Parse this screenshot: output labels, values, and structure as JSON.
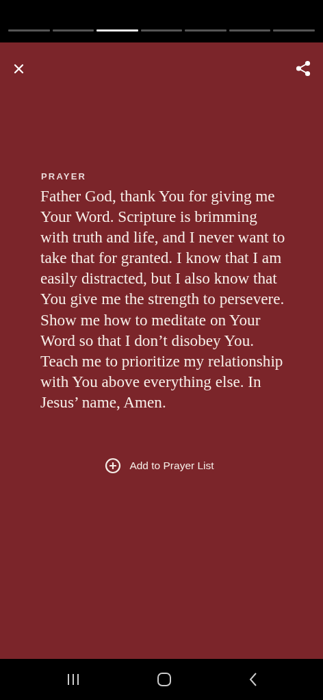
{
  "story_progress": [
    {
      "selected": false
    },
    {
      "selected": false
    },
    {
      "selected": true
    },
    {
      "selected": false
    },
    {
      "selected": false
    },
    {
      "selected": false
    },
    {
      "selected": false
    }
  ],
  "prayer": {
    "label": "PRAYER",
    "text": "Father God, thank You for giving me Your Word. Scripture is brimming with truth and life, and I never want to take that for granted. I know that I am easily distracted, but I also know that You give me the strength to persevere. Show me how to meditate on Your Word so that I don’t disobey You. Teach me to prioritize my relationship with You above everything else. In Jesus’ name, Amen."
  },
  "add_button": {
    "label": "Add to Prayer List"
  }
}
